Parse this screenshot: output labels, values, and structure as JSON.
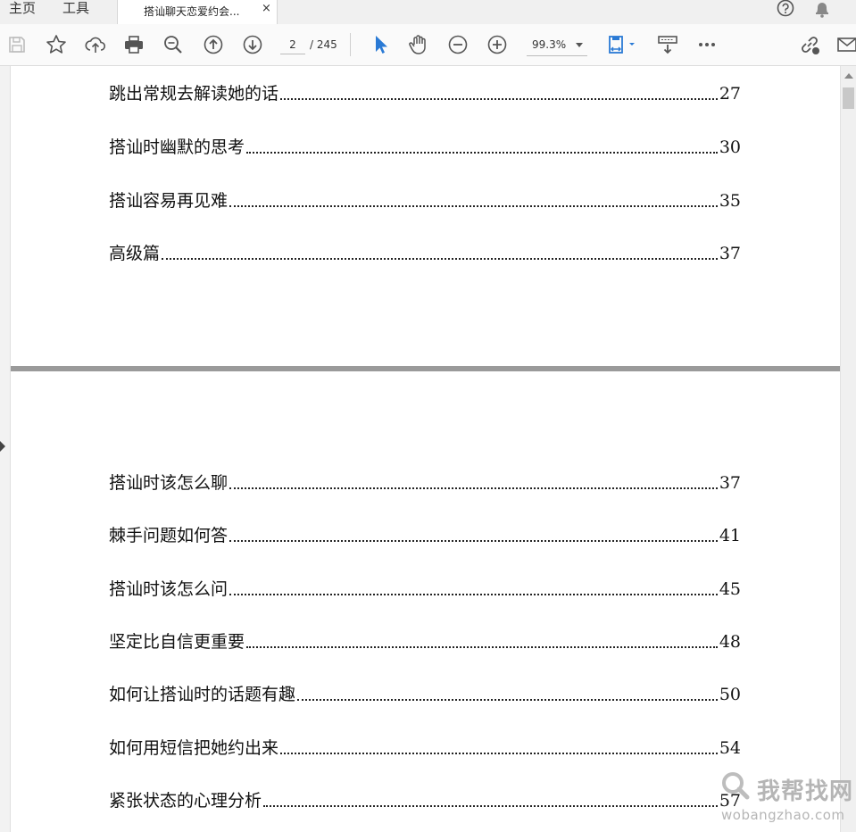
{
  "tabs": {
    "home_label": "主页",
    "tools_label": "工具",
    "document_title": "搭讪聊天恋爱约会...",
    "close_glyph": "×"
  },
  "toolbar": {
    "current_page": "2",
    "page_total": "/ 245",
    "zoom": "99.3%",
    "accent_color": "#2a7ad5",
    "icons": [
      "save-icon",
      "bookmark-star-icon",
      "upload-cloud-icon",
      "print-icon",
      "zoom-search-icon",
      "page-up-icon",
      "page-down-icon",
      "select-cursor-icon",
      "hand-tool-icon",
      "zoom-out-icon",
      "zoom-in-icon",
      "fit-page-icon",
      "scroll-mode-icon",
      "more-icon",
      "share-link-icon",
      "mail-icon",
      "help-icon",
      "notification-bell-icon"
    ]
  },
  "document": {
    "page1_entries": [
      {
        "title": "跳出常规去解读她的话",
        "page": "27"
      },
      {
        "title": "搭讪时幽默的思考",
        "page": "30"
      },
      {
        "title": "搭讪容易再见难",
        "page": "35"
      },
      {
        "title": "高级篇",
        "page": "37"
      }
    ],
    "page2_entries": [
      {
        "title": "搭讪时该怎么聊",
        "page": "37"
      },
      {
        "title": "棘手问题如何答",
        "page": "41"
      },
      {
        "title": "搭讪时该怎么问",
        "page": "45"
      },
      {
        "title": "坚定比自信更重要",
        "page": "48"
      },
      {
        "title": "如何让搭讪时的话题有趣",
        "page": "50"
      },
      {
        "title": "如何用短信把她约出来",
        "page": "54"
      },
      {
        "title": "紧张状态的心理分析",
        "page": "57"
      }
    ]
  },
  "watermark": {
    "name": "我帮找网",
    "url": "wobangzhao.com"
  }
}
